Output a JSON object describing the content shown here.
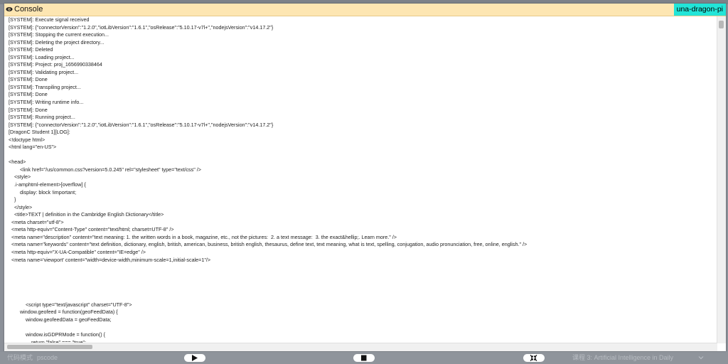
{
  "console": {
    "title": "Console",
    "device": "una-dragon-pi"
  },
  "log_lines": [
    "[SYSTEM]: Execute signal received",
    "[SYSTEM]: {\"connectorVersion\":\"1.2.0\",\"iotLibVersion\":\"1.6.1\",\"osRelease\":\"5.10.17-v7l+\",\"nodejsVersion\":\"v14.17.2\"}",
    "[SYSTEM]: Stopping the current execution...",
    "[SYSTEM]: Deleting the project directory...",
    "[SYSTEM]: Deleted",
    "[SYSTEM]: Loading project...",
    "[SYSTEM]: Project: proj_1656990338464",
    "[SYSTEM]: Validating project...",
    "[SYSTEM]: Done",
    "[SYSTEM]: Transpiling project...",
    "[SYSTEM]: Done",
    "[SYSTEM]: Writing runtime info...",
    "[SYSTEM]: Done",
    "[SYSTEM]: Running project...",
    "[SYSTEM]: {\"connectorVersion\":\"1.2.0\",\"iotLibVersion\":\"1.6.1\",\"osRelease\":\"5.10.17-v7l+\",\"nodejsVersion\":\"v14.17.2\"}",
    "[DragonC Student 1][LOG]:",
    "<!doctype html>",
    "<html lang=\"en-US\">",
    "",
    "<head>",
    "        <link href=\"/us/common.css?version=5.0.245\" rel=\"stylesheet\" type=\"text/css\" />",
    "    <style>",
    "    .i-amphtml-element>[overflow] {",
    "        display: block !important;",
    "    }",
    "    </style>",
    "    <title>TEXT | definition in the Cambridge English Dictionary</title>",
    "  <meta charset=\"utf-8\">",
    "  <meta http-equiv=\"Content-Type\" content=\"text/html; charset=UTF-8\" />",
    "  <meta name=\"description\" content=\"text meaning: 1. the written words in a book, magazine, etc., not the pictures:  2. a text message:  3. the exact&hellip;. Learn more.\" />",
    "  <meta name=\"keywords\" content=\"text definition, dictionary, english, british, american, business, british english, thesaurus, define text, text meaning, what is text, spelling, conjugation, audio pronunciation, free, online, english.\" />",
    "  <meta http-equiv=\"X-UA-Compatible\" content=\"IE=edge\" />",
    "  <meta name='viewport' content=\"width=device-width,minimum-scale=1,initial-scale=1\"/>",
    "",
    "",
    "",
    "",
    "",
    "            <script type=\"text/javascript\" charset=\"UTF-8\">",
    "        window.geofeed = function(geoFeedData) {",
    "            window.geofeedData = geoFeedData;",
    "",
    "            window.isGDPRMode = function() {",
    "                return \"false\" === \"true\";",
    "            }"
  ],
  "bottom_bar": {
    "left_label": "代码模式",
    "code_label": "pscode",
    "course_label": "课程 3: Artificial Intelligence in Daily"
  },
  "icons": {
    "view": "eye-icon",
    "run": "play-icon",
    "stop": "stop-icon",
    "fit": "collapse-icon",
    "dropdown": "chevron-down-icon"
  },
  "colors": {
    "header_bg": "#fde6b2",
    "device_badge_bg": "#22e5d8",
    "page_bg": "#8c9199"
  }
}
